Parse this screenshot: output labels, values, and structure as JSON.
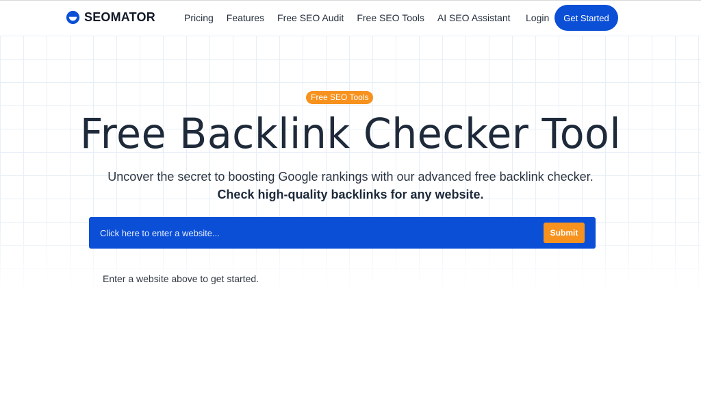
{
  "nav": {
    "logo_text": "SEOMATOR",
    "links": [
      "Pricing",
      "Features",
      "Free SEO Audit",
      "Free SEO Tools",
      "AI SEO Assistant"
    ],
    "login": "Login",
    "cta": "Get Started"
  },
  "hero": {
    "badge": "Free SEO Tools",
    "title": "Free Backlink Checker Tool",
    "subtitle": "Uncover the secret to boosting Google rankings with our advanced free backlink checker.",
    "subtitle_bold": "Check high-quality backlinks for any website."
  },
  "search": {
    "placeholder": "Click here to enter a website...",
    "value": "",
    "submit_label": "Submit"
  },
  "hint": "Enter a website above to get started.",
  "colors": {
    "brand_blue": "#0b4fd6",
    "accent_orange": "#f7921e",
    "heading": "#1e2a3a"
  },
  "icons": {
    "logo": "seomator-logo-icon"
  }
}
